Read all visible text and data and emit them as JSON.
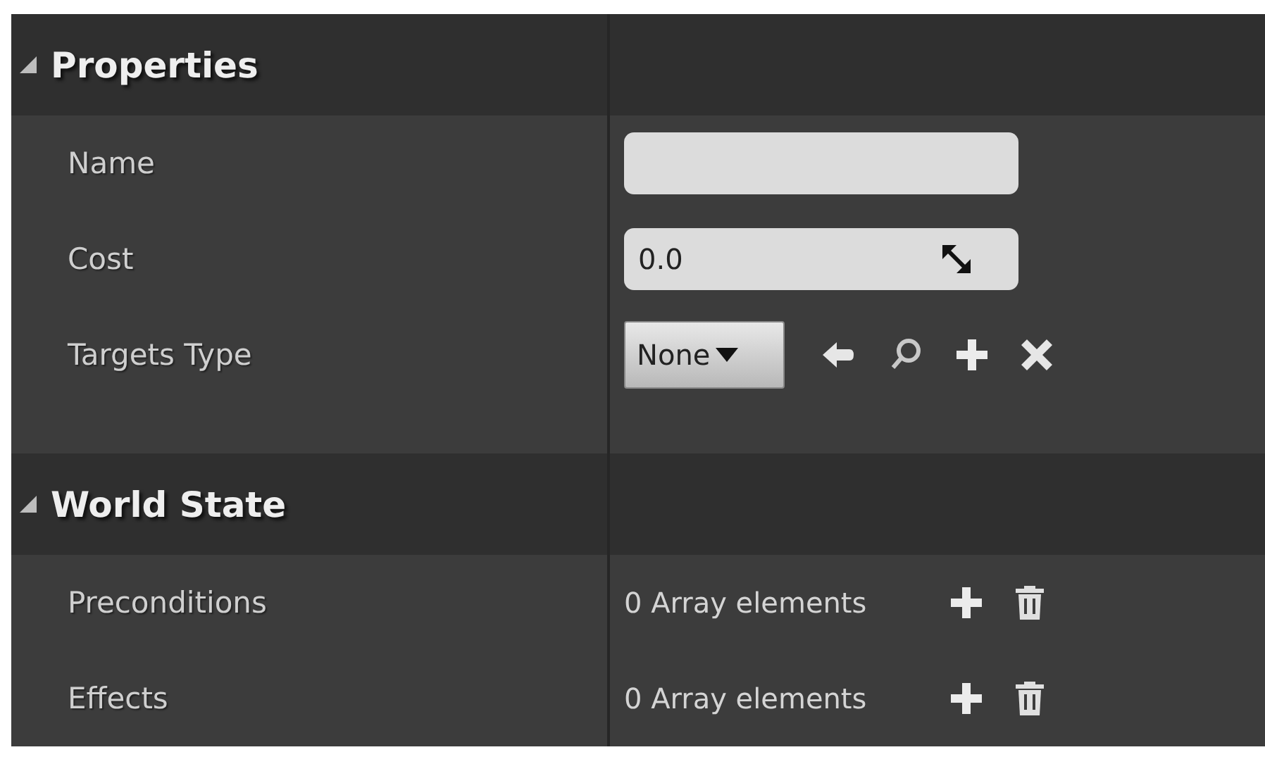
{
  "sections": [
    {
      "title": "Properties",
      "expanded": true,
      "rows": [
        {
          "kind": "text",
          "label": "Name"
        },
        {
          "kind": "number",
          "label": "Cost",
          "value": "0.0"
        },
        {
          "kind": "class",
          "label": "Targets Type",
          "value": "None"
        }
      ]
    },
    {
      "title": "World State",
      "expanded": true,
      "rows": [
        {
          "kind": "array",
          "label": "Preconditions",
          "value": "0 Array elements"
        },
        {
          "kind": "array",
          "label": "Effects",
          "value": "0 Array elements"
        }
      ]
    }
  ]
}
